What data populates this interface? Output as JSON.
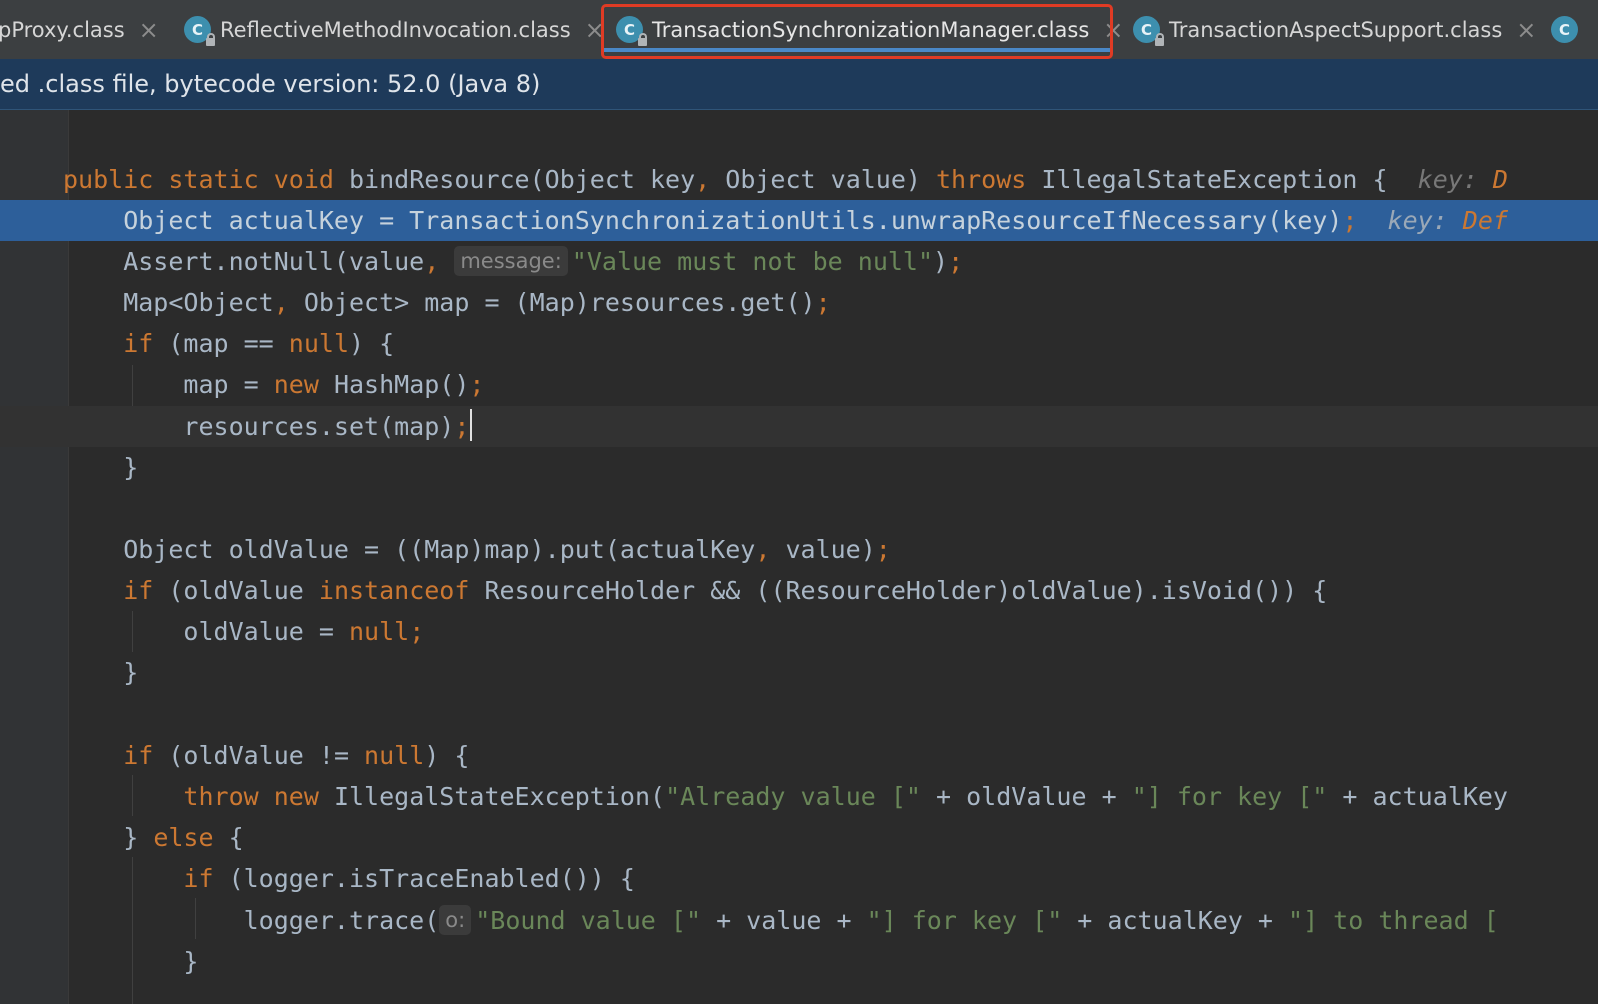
{
  "tabs": [
    {
      "label": "pProxy.class",
      "active": false
    },
    {
      "label": "ReflectiveMethodInvocation.class",
      "active": false
    },
    {
      "label": "TransactionSynchronizationManager.class",
      "active": true
    },
    {
      "label": "TransactionAspectSupport.class",
      "active": false
    }
  ],
  "tab_icon_letter": "C",
  "close_glyph": "×",
  "banner": "ed .class file, bytecode version: 52.0 (Java 8)",
  "code": {
    "l1": {
      "a": "public static void ",
      "b": "bindResource(Object key",
      "c": ", ",
      "d": "Object value) ",
      "e": "throws ",
      "f": "IllegalStateException {",
      "hint_key": "key: ",
      "hint_val": "D"
    },
    "l2": {
      "a": "    Object actualKey = TransactionSynchronizationUtils.unwrapResourceIfNecessary(key)",
      "b": ";",
      "hint_key": "key: ",
      "hint_val": "Def"
    },
    "l3": {
      "a": "    Assert.notNull(value",
      "b": ", ",
      "inlay": "message:",
      "c": "\"Value must not be null\"",
      "d": ")",
      "e": ";"
    },
    "l4": {
      "a": "    Map<Object",
      "b": ", ",
      "c": "Object> map = (Map)resources.get()",
      "d": ";"
    },
    "l5": {
      "a": "    ",
      "b": "if ",
      "c": "(map == ",
      "d": "null",
      "e": ") {"
    },
    "l6": {
      "a": "        map = ",
      "b": "new ",
      "c": "HashMap()",
      "d": ";"
    },
    "l7": {
      "a": "        resources.set(map)",
      "b": ";"
    },
    "l8": {
      "a": "    }"
    },
    "l10": {
      "a": "    Object oldValue = ((Map)map).put(actualKey",
      "b": ", ",
      "c": "value)",
      "d": ";"
    },
    "l11": {
      "a": "    ",
      "b": "if ",
      "c": "(oldValue ",
      "d": "instanceof ",
      "e": "ResourceHolder && ((ResourceHolder)oldValue).isVoid()) {"
    },
    "l12": {
      "a": "        oldValue = ",
      "b": "null",
      "c": ";"
    },
    "l13": {
      "a": "    }"
    },
    "l15": {
      "a": "    ",
      "b": "if ",
      "c": "(oldValue != ",
      "d": "null",
      "e": ") {"
    },
    "l16": {
      "a": "        ",
      "b": "throw new ",
      "c": "IllegalStateException(",
      "d": "\"Already value [\" ",
      "e": "+ oldValue + ",
      "f": "\"] for key [\" ",
      "g": "+ actualKey"
    },
    "l17": {
      "a": "    } ",
      "b": "else ",
      "c": "{"
    },
    "l18": {
      "a": "        ",
      "b": "if ",
      "c": "(logger.isTraceEnabled()) {"
    },
    "l19": {
      "a": "            logger.trace(",
      "inlay": "o:",
      "b": "\"Bound value [\" ",
      "c": "+ value + ",
      "d": "\"] for key [\" ",
      "e": "+ actualKey + ",
      "f": "\"] to thread ["
    },
    "l20": {
      "a": "        }"
    }
  },
  "colors": {
    "keyword": "#cc7832",
    "string": "#6a8759",
    "text": "#a9b7c6",
    "exec_line": "#2d5f9a",
    "highlight_box": "#e03b24"
  }
}
